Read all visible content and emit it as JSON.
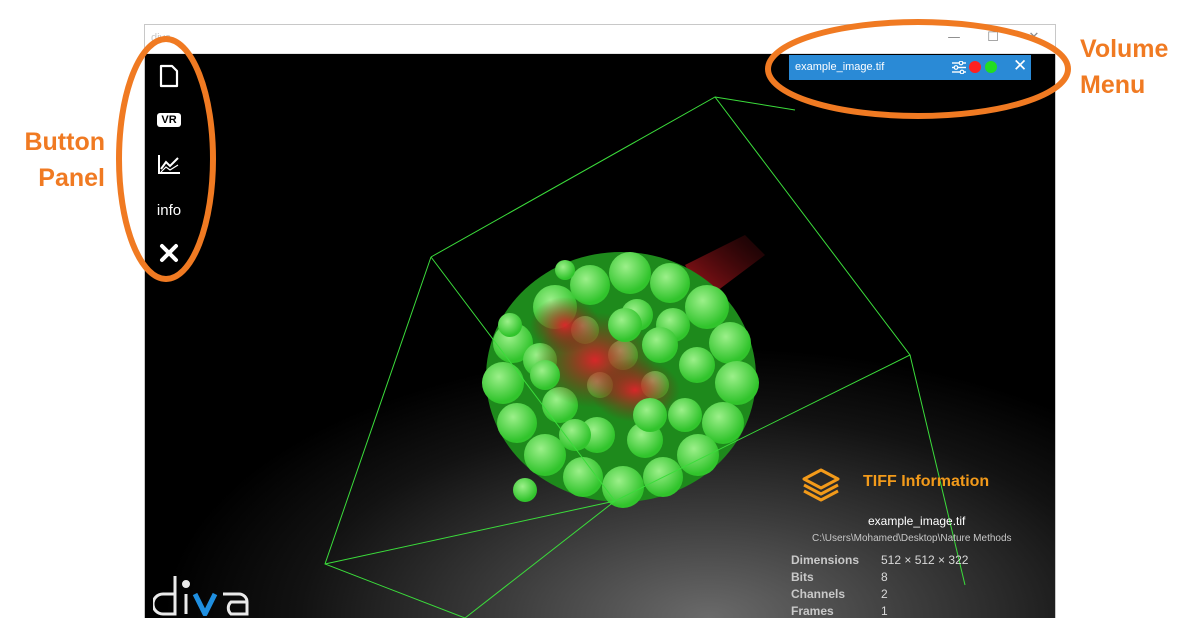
{
  "window": {
    "title": "diva",
    "minimize_glyph": "—",
    "maximize_glyph": "☐",
    "close_glyph": "✕"
  },
  "button_panel": {
    "buttons": [
      {
        "icon": "file-icon"
      },
      {
        "label": "VR",
        "icon": "vr-icon"
      },
      {
        "icon": "chart-icon"
      },
      {
        "label": "info"
      },
      {
        "icon": "close-icon"
      }
    ]
  },
  "volume_menu": {
    "filename": "example_image.tif",
    "channel_colors": [
      "#ff2020",
      "#22dd22"
    ],
    "close_glyph": "✕"
  },
  "tiff_info": {
    "title": "TIFF Information",
    "filename": "example_image.tif",
    "path": "C:\\Users\\Mohamed\\Desktop\\Nature Methods",
    "rows": [
      {
        "key": "Dimensions",
        "value": "512 × 512 × 322"
      },
      {
        "key": "Bits",
        "value": "8"
      },
      {
        "key": "Channels",
        "value": "2"
      },
      {
        "key": "Frames",
        "value": "1"
      }
    ]
  },
  "logo": {
    "text": "diva"
  },
  "annotations": {
    "button_panel_label": [
      "Button",
      "Panel"
    ],
    "volume_menu_label": [
      "Volume",
      "Menu"
    ],
    "color": "#f07a22"
  }
}
